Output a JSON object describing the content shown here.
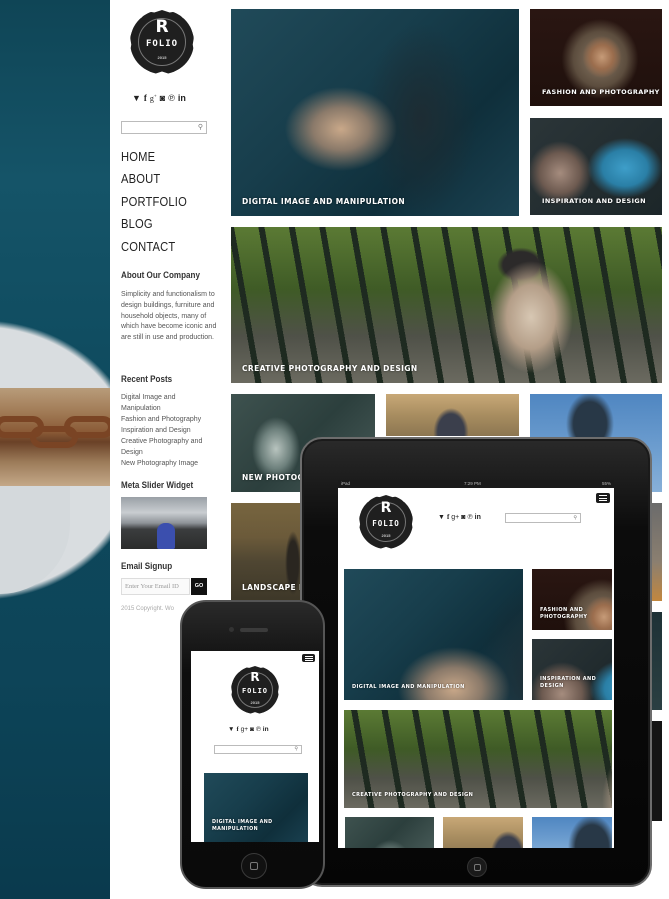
{
  "brand": {
    "logo_letter": "R",
    "logo_name": "FOLIO",
    "logo_year": "2015"
  },
  "social_icons": [
    {
      "name": "twitter-icon",
      "glyph": "🐦︎",
      "label": "t"
    },
    {
      "name": "facebook-icon",
      "label": "f"
    },
    {
      "name": "google-plus-icon",
      "label": "g+"
    },
    {
      "name": "instagram-icon",
      "label": "◘"
    },
    {
      "name": "pinterest-icon",
      "label": "℗"
    },
    {
      "name": "linkedin-icon",
      "label": "in"
    }
  ],
  "search": {
    "placeholder": "",
    "icon": "🔍"
  },
  "nav": {
    "items": [
      "HOME",
      "ABOUT",
      "PORTFOLIO",
      "BLOG",
      "CONTACT"
    ]
  },
  "about": {
    "title": "About Our Company",
    "text": "Simplicity and functionalism to design buildings, furniture and household objects, many of which have become iconic and are still in use and production."
  },
  "recent_posts": {
    "title": "Recent Posts",
    "items": [
      "Digital Image and Manipulation",
      "Fashion and Photography",
      "Inspiration and Design",
      "Creative Photography and Design",
      "New Photography Image"
    ]
  },
  "slider": {
    "title": "Meta Slider Widget"
  },
  "email_signup": {
    "title": "Email Signup",
    "placeholder": "Enter Your Email ID",
    "button": "GO"
  },
  "footer": {
    "copyright": "2015 Copyright. Wo"
  },
  "portfolio": {
    "tiles": [
      {
        "caption": "DIGITAL IMAGE AND MANIPULATION"
      },
      {
        "caption": "FASHION AND PHOTOGRAPHY"
      },
      {
        "caption": "INSPIRATION AND DESIGN"
      },
      {
        "caption": "CREATIVE PHOTOGRAPHY AND DESIGN"
      },
      {
        "caption": "NEW PHOTOGRA"
      },
      {
        "caption": "LANDSCAPE PHO"
      }
    ]
  },
  "ipad": {
    "status_left": "iPad",
    "status_time": "7:29 PM",
    "status_right": "55%",
    "tiles": [
      {
        "caption": "DIGITAL IMAGE AND MANIPULATION"
      },
      {
        "caption_l1": "FASHION AND",
        "caption_l2": "PHOTOGRAPHY"
      },
      {
        "caption_l1": "INSPIRATION AND",
        "caption_l2": "DESIGN"
      },
      {
        "caption": "CREATIVE PHOTOGRAPHY AND DESIGN"
      }
    ]
  },
  "iphone": {
    "tile": {
      "caption_l1": "DIGITAL IMAGE AND",
      "caption_l2": "MANIPULATION"
    }
  }
}
